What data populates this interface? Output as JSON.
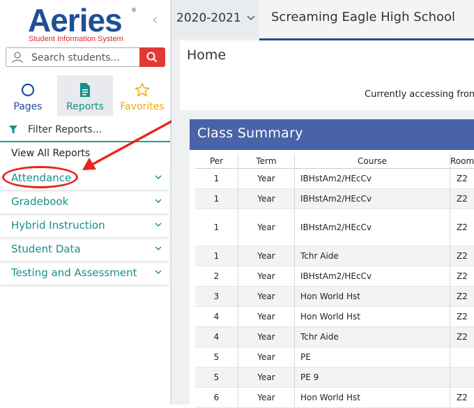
{
  "brand": {
    "logo_word": "Aeries",
    "logo_reg": "®",
    "logo_sub": "Student Information System",
    "colors": {
      "logo_blue": "#1f4f95",
      "logo_red": "#e0262d",
      "accent_teal": "#14908c",
      "header_blue": "#4a63a8"
    }
  },
  "search": {
    "placeholder": "Search students...",
    "icon": "search-icon"
  },
  "tabs": [
    {
      "label": "Pages",
      "icon": "circle-icon"
    },
    {
      "label": "Reports",
      "icon": "document-icon"
    },
    {
      "label": "Favorites",
      "icon": "star-icon"
    }
  ],
  "filter": {
    "placeholder": "Filter Reports...",
    "icon": "filter-icon"
  },
  "view_all_label": "View All Reports",
  "menu": [
    {
      "label": "Attendance"
    },
    {
      "label": "Gradebook"
    },
    {
      "label": "Hybrid Instruction"
    },
    {
      "label": "Student Data"
    },
    {
      "label": "Testing and Assessment"
    }
  ],
  "topbar": {
    "year": "2020-2021",
    "school": "Screaming Eagle High School"
  },
  "home": {
    "title": "Home",
    "access_text": "Currently accessing from"
  },
  "class_summary": {
    "title": "Class Summary",
    "columns": [
      "Per",
      "Term",
      "Course",
      "Room"
    ],
    "rows": [
      {
        "per": "1",
        "term": "Year",
        "course": "IBHstAm2/HEcCv",
        "room": "Z2"
      },
      {
        "per": "1",
        "term": "Year",
        "course": "IBHstAm2/HEcCv",
        "room": "Z2"
      },
      {
        "per": "1",
        "term": "Year",
        "course": "IBHstAm2/HEcCv",
        "room": "Z2"
      },
      {
        "per": "1",
        "term": "Year",
        "course": "Tchr Aide",
        "room": "Z2"
      },
      {
        "per": "2",
        "term": "Year",
        "course": "IBHstAm2/HEcCv",
        "room": "Z2"
      },
      {
        "per": "3",
        "term": "Year",
        "course": "Hon World Hst",
        "room": "Z2"
      },
      {
        "per": "4",
        "term": "Year",
        "course": "Hon World Hst",
        "room": "Z2"
      },
      {
        "per": "4",
        "term": "Year",
        "course": "Tchr Aide",
        "room": "Z2"
      },
      {
        "per": "5",
        "term": "Year",
        "course": "PE",
        "room": ""
      },
      {
        "per": "5",
        "term": "Year",
        "course": "PE 9",
        "room": ""
      },
      {
        "per": "6",
        "term": "Year",
        "course": "Hon World Hst",
        "room": "Z2"
      }
    ]
  }
}
